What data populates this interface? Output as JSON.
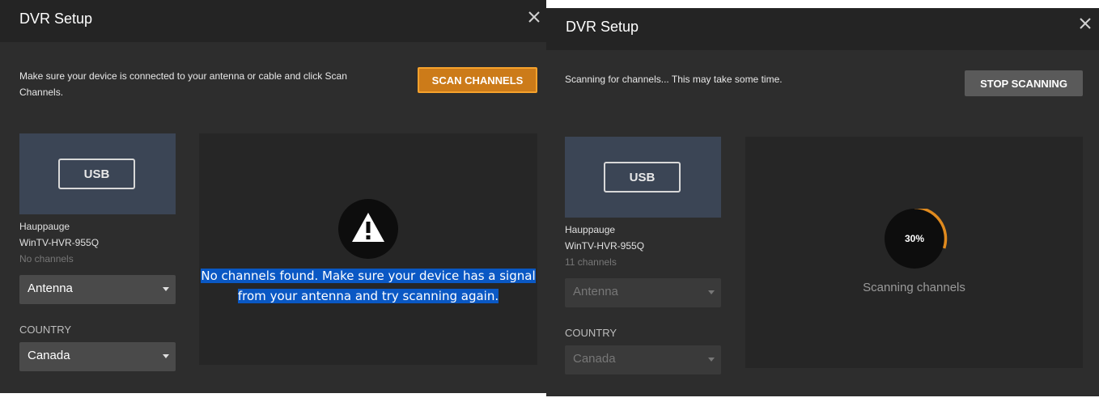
{
  "left_dialog": {
    "title": "DVR Setup",
    "description": "Make sure your device is connected to your antenna or cable and click Scan Channels.",
    "scan_button": "SCAN CHANNELS",
    "device": {
      "badge": "USB",
      "name_line1": "Hauppauge",
      "name_line2": "WinTV-HVR-955Q",
      "channels": "No channels"
    },
    "source_select": "Antenna",
    "country_label": "COUNTRY",
    "country_select": "Canada",
    "message": "No channels found. Make sure your device has a signal from your antenna and try scanning again."
  },
  "right_dialog": {
    "title": "DVR Setup",
    "description": "Scanning for channels... This may take some time.",
    "stop_button": "STOP SCANNING",
    "device": {
      "badge": "USB",
      "name_line1": "Hauppauge",
      "name_line2": "WinTV-HVR-955Q",
      "channels": "11 channels"
    },
    "source_select": "Antenna",
    "country_label": "COUNTRY",
    "country_select": "Canada",
    "progress_percent": 30,
    "progress_text": "30%",
    "status": "Scanning channels"
  },
  "colors": {
    "accent": "#cc7b19",
    "selection": "#0a58c4",
    "progress": "#e08a1e"
  },
  "icons": {
    "close": "close-icon",
    "warning": "warning-icon",
    "chevron": "chevron-down-icon"
  }
}
